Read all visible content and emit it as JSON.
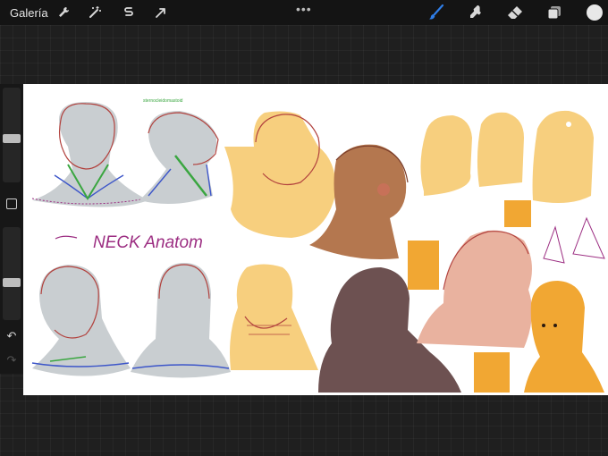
{
  "toolbar": {
    "gallery_label": "Galería",
    "more_label": "•••",
    "icons": [
      "wrench-icon",
      "magic-wand-icon",
      "selection-icon",
      "transform-arrow-icon",
      "brush-icon",
      "smudge-icon",
      "eraser-icon",
      "layers-icon",
      "color-swatch"
    ],
    "active_tool": "brush",
    "accent_color": "#2f7ee8",
    "current_color": "#e8e8e8"
  },
  "canvas": {
    "handwritten_title": "NECK Anatom",
    "small_note": "sternocleidomastoid",
    "palette": {
      "skin_yellow": "#f7cf7e",
      "skin_orange": "#f1a733",
      "skin_peach": "#e9b29f",
      "skin_brown": "#b4774f",
      "skin_dark": "#6d5151",
      "sketch_gray": "#c9ced1",
      "line_red": "#b2423e",
      "line_blue": "#3d56c9",
      "line_green": "#3aa640",
      "line_purple": "#9c2e82"
    }
  }
}
